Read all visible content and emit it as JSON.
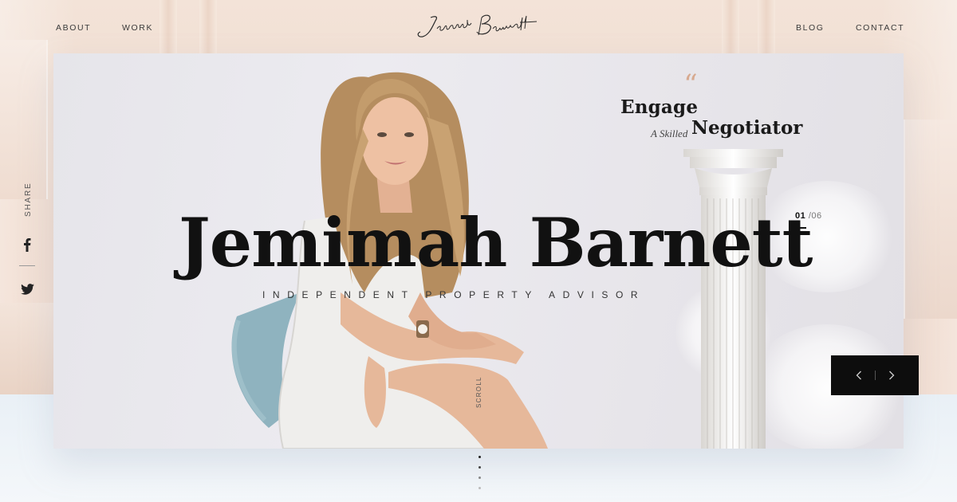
{
  "nav": {
    "about": "ABOUT",
    "work": "WORK",
    "blog": "BLOG",
    "contact": "CONTACT",
    "logo_text": "Jemimah Barnett"
  },
  "hero": {
    "quote_mark": "“",
    "tagline": {
      "engage": "Engage",
      "skilled": "A Skilled",
      "negotiator": "Negotiator"
    },
    "name": "Jemimah Barnett",
    "subtitle": "INDEPENDENT PROPERTY ADVISOR",
    "slide_current": "01",
    "slide_total": "/06",
    "scroll_label": "SCROLL"
  },
  "share": {
    "label": "SHARE",
    "icons": [
      "facebook-icon",
      "twitter-icon"
    ]
  },
  "slider": {
    "prev_icon": "chevron-left-icon",
    "next_icon": "chevron-right-icon"
  },
  "colors": {
    "accent_quote": "#d7a98f",
    "text_dark": "#111111",
    "slider_bg": "#0d0d0d",
    "room_bg": "#efd9cb"
  }
}
